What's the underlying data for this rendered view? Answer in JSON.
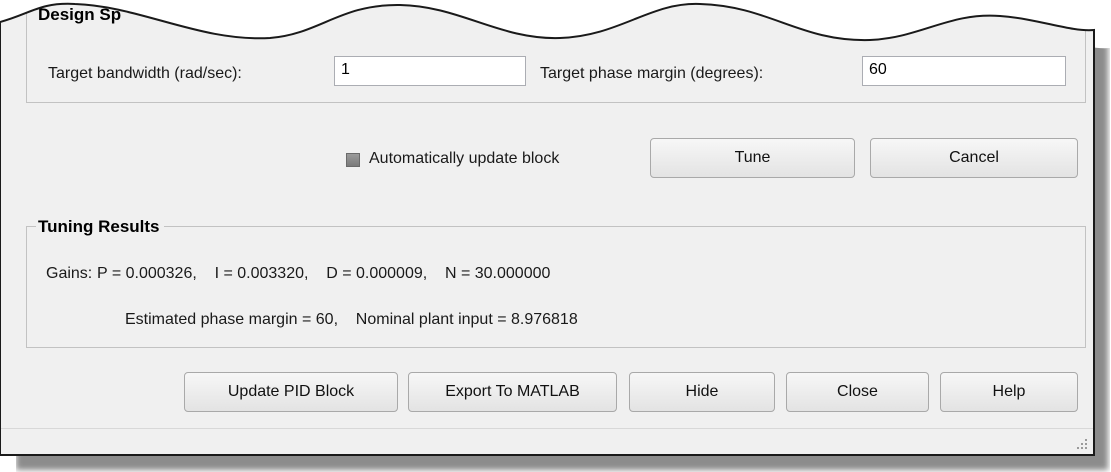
{
  "design_specs": {
    "title": "Design Sp",
    "bandwidth_label": "Target bandwidth (rad/sec):",
    "bandwidth_value": "1",
    "phase_margin_label": "Target phase margin (degrees):",
    "phase_margin_value": "60"
  },
  "controls": {
    "auto_update_label": "Automatically update block",
    "auto_update_checked": false,
    "tune_label": "Tune",
    "cancel_label": "Cancel"
  },
  "tuning_results": {
    "title": "Tuning Results",
    "gains_label": "Gains:",
    "gains_text": "P = 0.000326,    I = 0.003320,    D = 0.000009,    N = 30.000000",
    "estimate_text": "Estimated phase margin = 60,    Nominal plant input = 8.976818"
  },
  "footer_buttons": {
    "update_pid": "Update PID Block",
    "export": "Export To MATLAB",
    "hide": "Hide",
    "close": "Close",
    "help": "Help"
  },
  "colors": {
    "dialog_bg": "#f0f0f0",
    "group_border": "#c2c2c2",
    "checkbox_fill": "#8a8a8a"
  }
}
